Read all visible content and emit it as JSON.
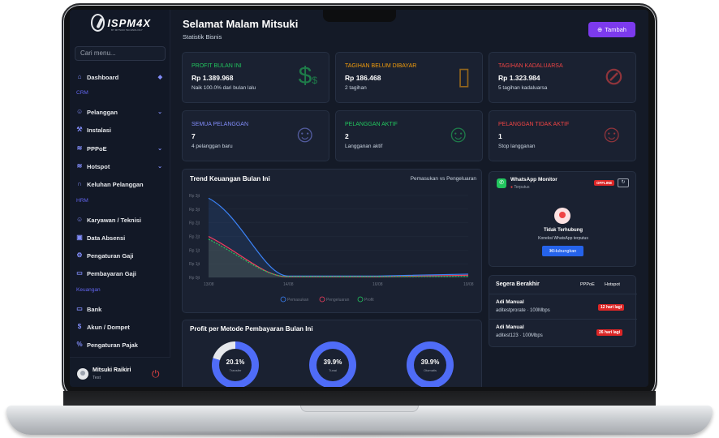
{
  "app": {
    "logo_text": "ISPM4X",
    "logo_sub": "BY MITSUKI TECHNOLOGY"
  },
  "sidebar": {
    "search_placeholder": "Cari menu...",
    "items": [
      {
        "label": "Dashboard",
        "icon": "home-icon"
      },
      {
        "label": "CRM",
        "section": true
      },
      {
        "label": "Pelanggan",
        "icon": "users-icon"
      },
      {
        "label": "Instalasi",
        "icon": "wrench-icon"
      },
      {
        "label": "PPPoE",
        "icon": "wifi-icon"
      },
      {
        "label": "Hotspot",
        "icon": "wifi-icon"
      },
      {
        "label": "Keluhan Pelanggan",
        "icon": "headset-icon"
      },
      {
        "label": "HRM",
        "section": true
      },
      {
        "label": "Karyawan / Teknisi",
        "icon": "users-icon"
      },
      {
        "label": "Data Absensi",
        "icon": "calendar-icon"
      },
      {
        "label": "Pengaturan Gaji",
        "icon": "gear-icon"
      },
      {
        "label": "Pembayaran Gaji",
        "icon": "card-icon"
      },
      {
        "label": "Keuangan",
        "section": true
      },
      {
        "label": "Bank",
        "icon": "card-icon"
      },
      {
        "label": "Akun / Dompet",
        "icon": "dollar-icon"
      },
      {
        "label": "Pengaturan Pajak",
        "icon": "percent-icon"
      }
    ],
    "user": {
      "name": "Mitsuki Raikiri",
      "role": "Test"
    }
  },
  "header": {
    "title": "Selamat Malam Mitsuki",
    "subtitle": "Statistik Bisnis",
    "add_button": "Tambah"
  },
  "cards": [
    {
      "label": "PROFIT BULAN INI",
      "value": "Rp 1.389.968",
      "sub": "Naik 100.0% dari bulan lalu",
      "color": "#22c55e"
    },
    {
      "label": "TAGIHAN BELUM DIBAYAR",
      "value": "Rp 186.468",
      "sub": "2 tagihan",
      "color": "#f59e0b"
    },
    {
      "label": "TAGIHAN KADALUARSA",
      "value": "Rp 1.323.984",
      "sub": "5 tagihan kadaluarsa",
      "color": "#ef4444"
    },
    {
      "label": "SEMUA PELANGGAN",
      "value": "7",
      "sub": "4 pelanggan baru",
      "color": "#818cf8"
    },
    {
      "label": "PELANGGAN AKTIF",
      "value": "2",
      "sub": "Langganan aktif",
      "color": "#22c55e"
    },
    {
      "label": "PELANGGAN TIDAK AKTIF",
      "value": "1",
      "sub": "Stop langganan",
      "color": "#ef4444"
    }
  ],
  "trend": {
    "title": "Trend Keuangan Bulan Ini",
    "subtitle": "Pemasukan vs Pengeluaran",
    "y_ticks": [
      "Rp 3jt",
      "Rp 3jt",
      "Rp 2jt",
      "Rp 2jt",
      "Rp 1jt",
      "Rp 1jt",
      "Rp 0jt"
    ],
    "x_ticks": [
      "13/08",
      "14/08",
      "16/08",
      "19/08"
    ],
    "legend": [
      "Pemasukan",
      "Pengeluaran",
      "Profit"
    ]
  },
  "chart_data": {
    "type": "area",
    "x": [
      "13/08",
      "14/08",
      "16/08",
      "19/08"
    ],
    "series": [
      {
        "name": "Pemasukan",
        "values": [
          2.9,
          0.05,
          0.05,
          0.12
        ]
      },
      {
        "name": "Pengeluaran",
        "values": [
          1.5,
          0.02,
          0.02,
          0.08
        ]
      },
      {
        "name": "Profit",
        "values": [
          1.4,
          0.03,
          0.03,
          0.04
        ]
      }
    ],
    "ylim": [
      0,
      3.0
    ],
    "colors": {
      "Pemasukan": "#3b82f6",
      "Pengeluaran": "#f43f5e",
      "Profit": "#22c55e"
    }
  },
  "payment": {
    "title": "Profit per Metode Pembayaran Bulan Ini",
    "methods": [
      {
        "label": "Transfer",
        "pct": "20.1%",
        "value": 0.201
      },
      {
        "label": "Tunai",
        "pct": "39.9%",
        "value": 0.399
      },
      {
        "label": "Otomatis",
        "pct": "39.9%",
        "value": 0.399
      }
    ]
  },
  "whatsapp": {
    "title": "WhatsApp Monitor",
    "status": "Terputus",
    "badge": "OFFLINE",
    "message_title": "Tidak Terhubung",
    "message_sub": "Koneksi WhatsApp terputus",
    "button": "Hubungkan"
  },
  "expiring": {
    "title": "Segera Berakhir",
    "tabs": [
      "PPPoE",
      "Hotspot"
    ],
    "items": [
      {
        "name": "Adi Manual",
        "detail": "aditestprorate · 100Mbps",
        "badge": "12 hari lagi"
      },
      {
        "name": "Adi Manual",
        "detail": "aditest123 · 100Mbps",
        "badge": "26 hari lagi"
      }
    ]
  }
}
